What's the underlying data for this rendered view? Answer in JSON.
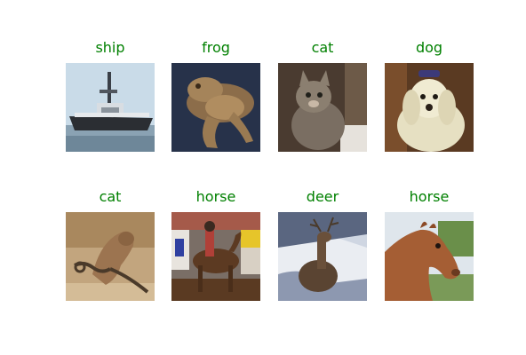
{
  "grid": {
    "label_color": "#008000",
    "items": [
      {
        "label": "ship",
        "icon": "ship-photo"
      },
      {
        "label": "frog",
        "icon": "frog-photo"
      },
      {
        "label": "cat",
        "icon": "cat-photo"
      },
      {
        "label": "dog",
        "icon": "dog-photo"
      },
      {
        "label": "cat",
        "icon": "cat-photo"
      },
      {
        "label": "horse",
        "icon": "horse-photo"
      },
      {
        "label": "deer",
        "icon": "deer-photo"
      },
      {
        "label": "horse",
        "icon": "horse-photo"
      }
    ]
  }
}
